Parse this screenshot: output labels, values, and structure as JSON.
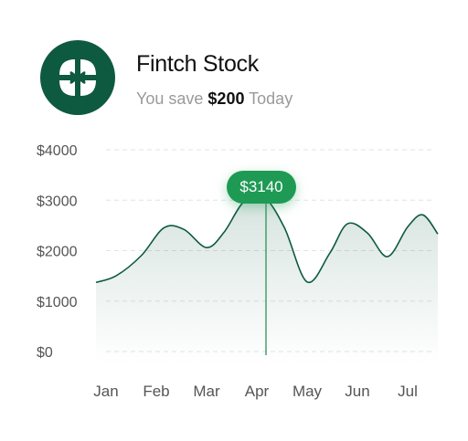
{
  "header": {
    "title": "Fintch Stock",
    "subtitle_prefix": "You save",
    "subtitle_amount": "$200",
    "subtitle_suffix": "Today"
  },
  "logo": {
    "icon": "fintch-logo-icon",
    "color": "#0e5a40"
  },
  "colors": {
    "line": "#0e5a40",
    "tooltip": "#1e9a54",
    "grid": "#e3e3e3"
  },
  "chart_data": {
    "type": "area",
    "categories": [
      "Jan",
      "Feb",
      "Mar",
      "Apr",
      "May",
      "Jun",
      "Jul"
    ],
    "series": [
      {
        "points": [
          [
            -0.2,
            1370
          ],
          [
            0.2,
            1500
          ],
          [
            0.7,
            1900
          ],
          [
            1.15,
            2450
          ],
          [
            1.55,
            2420
          ],
          [
            2.0,
            2060
          ],
          [
            2.35,
            2370
          ],
          [
            2.75,
            2980
          ],
          [
            3.15,
            3050
          ],
          [
            3.55,
            2450
          ],
          [
            4.0,
            1380
          ],
          [
            4.45,
            1950
          ],
          [
            4.8,
            2530
          ],
          [
            5.2,
            2350
          ],
          [
            5.6,
            1880
          ],
          [
            6.0,
            2470
          ],
          [
            6.3,
            2710
          ],
          [
            6.6,
            2330
          ]
        ]
      }
    ],
    "yticks": [
      0,
      1000,
      2000,
      3000,
      4000
    ],
    "ytick_labels": [
      "$0",
      "$1000",
      "$2000",
      "$3000",
      "$4000"
    ],
    "ylim": [
      0,
      4000
    ],
    "grid": true,
    "highlight": {
      "category": "Apr",
      "label": "$3140"
    }
  }
}
